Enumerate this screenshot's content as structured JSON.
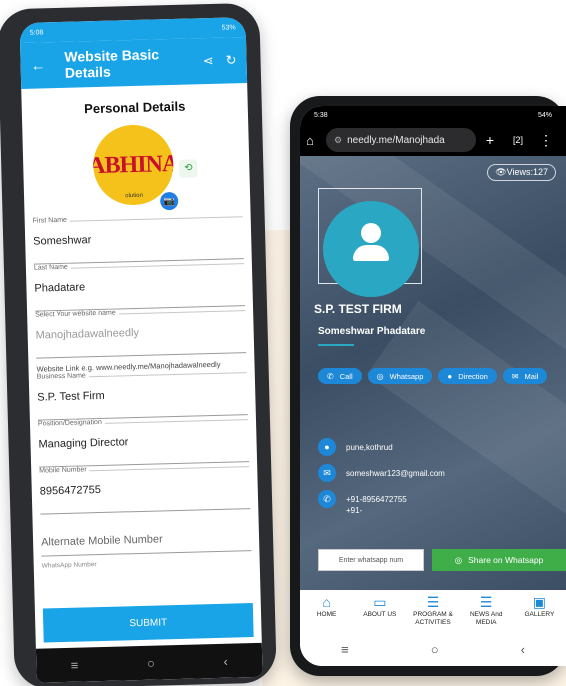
{
  "left_phone": {
    "status_time": "5:08",
    "status_right": "53%",
    "appbar_title": "Website Basic Details",
    "back_icon": "arrow-left-icon",
    "section_title": "Personal Details",
    "logo_text": "ABHINA",
    "logo_sub": "olution",
    "fields": [
      {
        "label": "First Name",
        "value": "Someshwar"
      },
      {
        "label": "Last Name",
        "value": "Phadatare"
      },
      {
        "label": "Select Your website name",
        "value": "Manojhadawalneedly"
      }
    ],
    "website_hint": "Website Link e.g. www.needly.me/Manojhadawalneedly",
    "fields2": [
      {
        "label": "Business Name",
        "value": "S.P. Test Firm"
      },
      {
        "label": "Position/Designation",
        "value": "Managing Director"
      },
      {
        "label": "Mobile Number",
        "value": "8956472755"
      }
    ],
    "alternate_placeholder": "Alternate Mobile Number",
    "whatsapp_label": "WhatsApp Number",
    "submit_label": "SUBMIT"
  },
  "right_phone": {
    "status_time": "5:38",
    "status_right": "54%",
    "url": "needly.me/Manojhada",
    "tab_count": "2",
    "views": "Views:127",
    "firm_name": "S.P. TEST FIRM",
    "person_name": "Someshwar Phadatare",
    "buttons": [
      "Call",
      "Whatsapp",
      "Direction",
      "Mail"
    ],
    "address": "pune,kothrud",
    "email": "someshwar123@gmail.com",
    "phone_line1": "+91-8956472755",
    "phone_line2": "+91-",
    "whatsapp_placeholder": "Enter whatsapp num",
    "share_label": "Share on Whatsapp",
    "nav": [
      {
        "label": "HOME",
        "icon": "home-icon"
      },
      {
        "label": "ABOUT US",
        "icon": "briefcase-icon"
      },
      {
        "label": "PROGRAM & ACTIVITIES",
        "icon": "tasks-icon"
      },
      {
        "label": "NEWS And MEDIA",
        "icon": "news-icon"
      },
      {
        "label": "GALLERY",
        "icon": "gallery-icon"
      }
    ]
  }
}
